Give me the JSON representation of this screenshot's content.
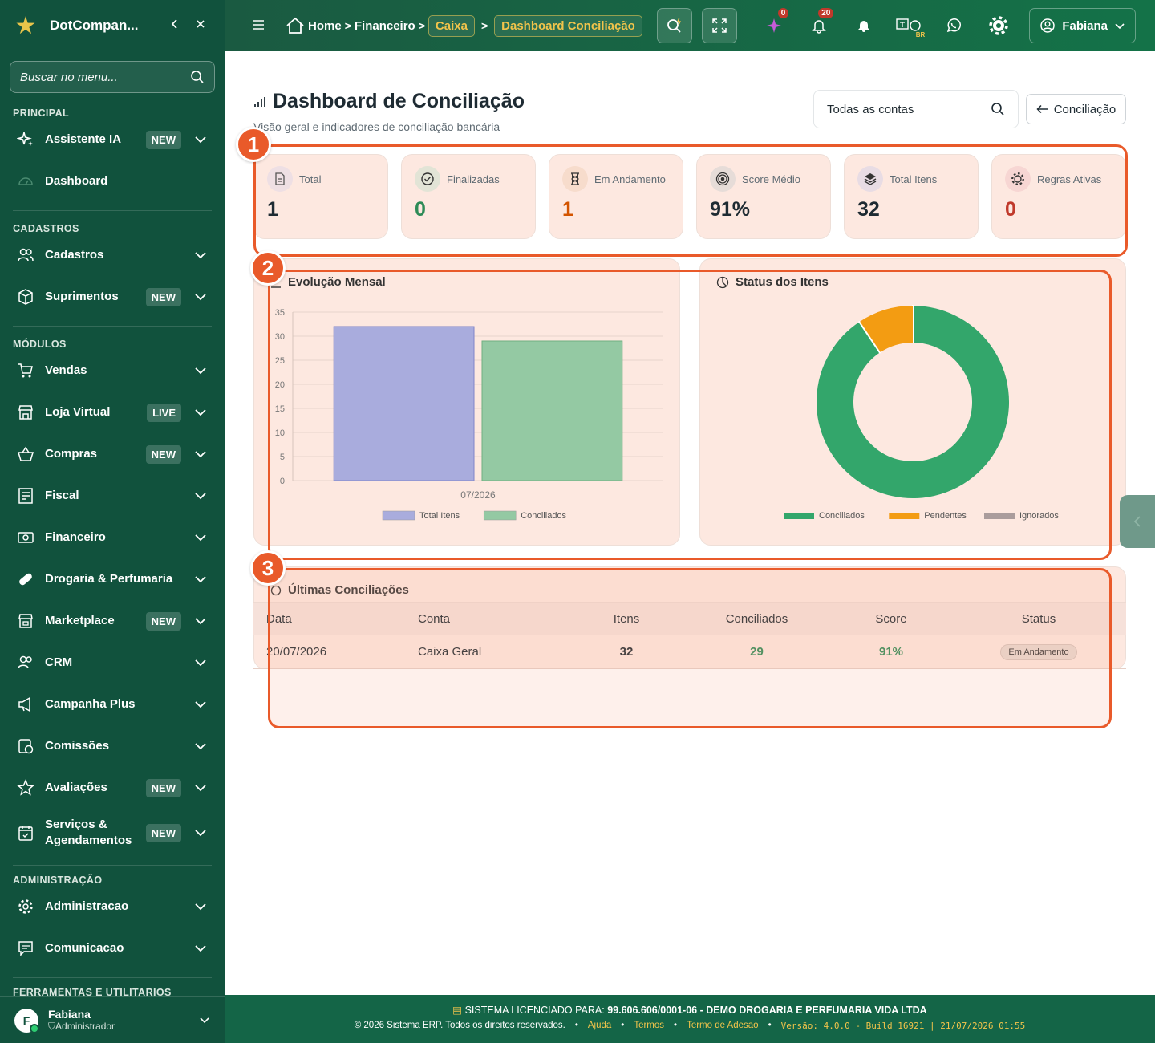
{
  "sidebar": {
    "brand": "DotCompan...",
    "search_placeholder": "Buscar no menu...",
    "sections": {
      "principal": "PRINCIPAL",
      "cadastros": "CADASTROS",
      "modulos": "MÓDULOS",
      "administracao": "ADMINISTRAÇÃO",
      "ferramentas": "FERRAMENTAS E UTILITARIOS"
    },
    "items": [
      {
        "label": "Assistente IA",
        "badge": "NEW",
        "icon": "sparkle-icon"
      },
      {
        "label": "Dashboard",
        "icon": "gauge-icon"
      },
      {
        "label": "Cadastros",
        "icon": "users-icon"
      },
      {
        "label": "Suprimentos",
        "badge": "NEW",
        "icon": "box-icon"
      },
      {
        "label": "Vendas",
        "icon": "cart-icon"
      },
      {
        "label": "Loja Virtual",
        "badge": "LIVE",
        "icon": "store-icon"
      },
      {
        "label": "Compras",
        "badge": "NEW",
        "icon": "basket-icon"
      },
      {
        "label": "Fiscal",
        "icon": "receipt-icon"
      },
      {
        "label": "Financeiro",
        "icon": "cash-icon"
      },
      {
        "label": "Drogaria & Perfumaria",
        "icon": "pill-icon"
      },
      {
        "label": "Marketplace",
        "badge": "NEW",
        "icon": "shop-icon"
      },
      {
        "label": "CRM",
        "icon": "contacts-icon"
      },
      {
        "label": "Campanha Plus",
        "icon": "megaphone-icon"
      },
      {
        "label": "Comissões",
        "icon": "coins-icon"
      },
      {
        "label": "Avaliações",
        "badge": "NEW",
        "icon": "star-icon"
      },
      {
        "label": "Serviços & Agendamentos",
        "badge": "NEW",
        "icon": "calendar-icon"
      },
      {
        "label": "Administracao",
        "icon": "gear-icon"
      },
      {
        "label": "Comunicacao",
        "icon": "chat-icon"
      }
    ],
    "user": {
      "initial": "F",
      "name": "Fabiana",
      "role": "Administrador"
    }
  },
  "topbar": {
    "breadcrumb": [
      "Home",
      "Financeiro",
      "Caixa",
      "Dashboard Conciliação"
    ],
    "ai_count": "0",
    "notif_count": "20",
    "lang": "BR",
    "user": "Fabiana"
  },
  "page": {
    "title": "Dashboard de Conciliação",
    "subtitle": "Visão geral e indicadores de conciliação bancária",
    "account_select": "Todas as contas",
    "back_button": "Conciliação"
  },
  "kpis": [
    {
      "label": "Total",
      "value": "1",
      "color": "#1e2b33",
      "icon": "document-icon"
    },
    {
      "label": "Finalizadas",
      "value": "0",
      "color": "#2e8b57",
      "icon": "check-circle-icon"
    },
    {
      "label": "Em Andamento",
      "value": "1",
      "color": "#d35400",
      "icon": "hourglass-icon"
    },
    {
      "label": "Score Médio",
      "value": "91%",
      "color": "#1e2b33",
      "icon": "target-icon"
    },
    {
      "label": "Total Itens",
      "value": "32",
      "color": "#1e2b33",
      "icon": "layers-icon"
    },
    {
      "label": "Regras Ativas",
      "value": "0",
      "color": "#c0392b",
      "icon": "cog-icon"
    }
  ],
  "chart_data": [
    {
      "type": "bar",
      "title": "Evolução Mensal",
      "categories": [
        "07/2026"
      ],
      "series": [
        {
          "name": "Total Itens",
          "values": [
            32
          ],
          "color": "#a9acdd"
        },
        {
          "name": "Conciliados",
          "values": [
            29
          ],
          "color": "#94c9a3"
        }
      ],
      "ylim": [
        0,
        35
      ],
      "yticks": [
        0,
        5,
        10,
        15,
        20,
        25,
        30,
        35
      ],
      "legend": "bottom"
    },
    {
      "type": "pie",
      "title": "Status dos Itens",
      "labels": [
        "Conciliados",
        "Pendentes",
        "Ignorados"
      ],
      "values": [
        29,
        3,
        0
      ],
      "colors": [
        "#33a66b",
        "#f39c12",
        "#aa9c9c"
      ],
      "legend": "bottom"
    }
  ],
  "table": {
    "title": "Últimas Conciliações",
    "headers": [
      "Data",
      "Conta",
      "Itens",
      "Conciliados",
      "Score",
      "Status"
    ],
    "rows": [
      {
        "data": "20/07/2026",
        "conta": "Caixa Geral",
        "itens": "32",
        "conciliados": "29",
        "score": "91%",
        "status": "Em Andamento"
      }
    ]
  },
  "annotations": [
    "1",
    "2",
    "3"
  ],
  "footer": {
    "license_label": "SISTEMA LICENCIADO PARA:",
    "license_value": "99.606.606/0001-06 - DEMO DROGARIA E PERFUMARIA VIDA LTDA",
    "copyright": "© 2026 Sistema ERP. Todos os direitos reservados.",
    "links": [
      "Ajuda",
      "Termos",
      "Termo de Adesao"
    ],
    "version": "Versão: 4.0.0 - Build 16921 | 21/07/2026 01:55"
  },
  "colors": {
    "sidebar": "#11523d",
    "accent": "#e95a2a",
    "gold": "#f2c44b"
  }
}
